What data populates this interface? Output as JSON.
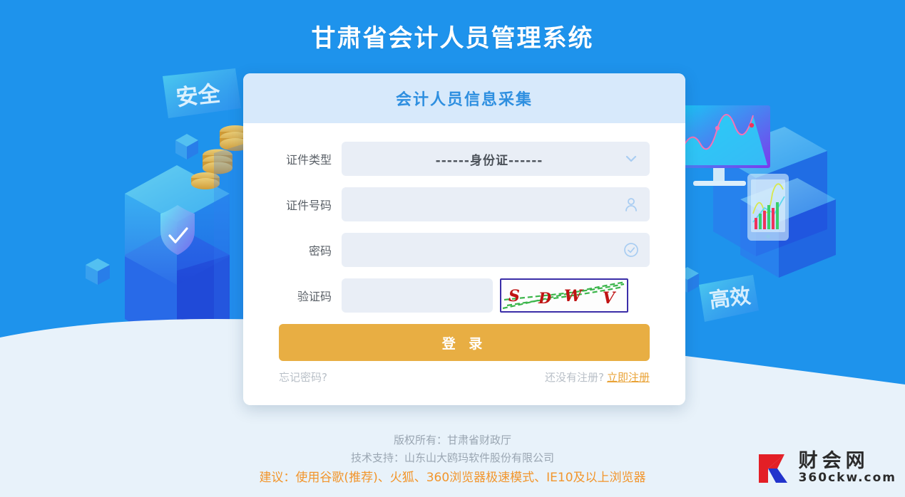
{
  "page": {
    "title": "甘肃省会计人员管理系统",
    "background_color": "#1E93EC",
    "bottom_band_color": "#E8F2FA"
  },
  "decor": {
    "left_badge_text": "安全",
    "right_badge_text": "高效",
    "shield_icon": "shield-check-icon",
    "monitor_icon": "monitor-chart-icon",
    "tablet_icon": "tablet-chart-icon",
    "coins_icon": "coin-stack-icon"
  },
  "card": {
    "header_title": "会计人员信息采集",
    "header_color": "#D7E9FB",
    "header_text_color": "#2E8FE0"
  },
  "form": {
    "fields": [
      {
        "label": "证件类型",
        "type": "select",
        "value": "------身份证------",
        "icon": "chevron-down-icon",
        "name": "id-type"
      },
      {
        "label": "证件号码",
        "type": "text",
        "value": "",
        "placeholder": "",
        "icon": "person-icon",
        "name": "id-number"
      },
      {
        "label": "密码",
        "type": "password",
        "value": "",
        "placeholder": "",
        "icon": "check-circle-icon",
        "name": "password"
      },
      {
        "label": "验证码",
        "type": "text",
        "value": "",
        "placeholder": "",
        "icon": "",
        "name": "captcha"
      }
    ],
    "captcha": {
      "text": "SDWV",
      "text_color": "#C01414",
      "line_color": "#3BB54A",
      "border_color": "#3B2EA8"
    },
    "login_button": {
      "label": "登 录",
      "color": "#E8AE43"
    },
    "links": {
      "forgot_password": "忘记密码?",
      "not_registered": "还没有注册?",
      "register_now": "立即注册",
      "register_color": "#E9A235"
    }
  },
  "footer": {
    "copyright": "版权所有：甘肃省财政厅",
    "support": "技术支持：山东山大鸥玛软件股份有限公司",
    "browser_tip": "建议：使用谷歌(推荐)、火狐、360浏览器极速模式、IE10及以上浏览器",
    "tip_color": "#F2952B"
  },
  "watermark": {
    "logo_letter": "K",
    "brand_cn": "财会网",
    "brand_url": "360ckw.com",
    "red": "#E31F26",
    "blue": "#2233CC"
  }
}
